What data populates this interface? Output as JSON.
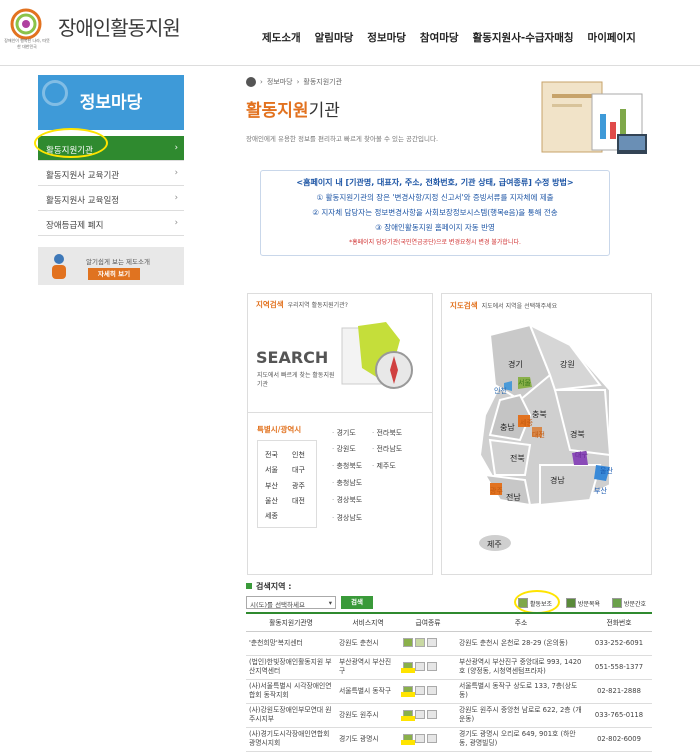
{
  "header": {
    "logo_title": "장애인활동지원",
    "logo_sub": "장애인이 행복한 나라, 따뜻한 대한민국",
    "gnb": [
      "제도소개",
      "알림마당",
      "정보마당",
      "참여마당",
      "활동지원사-수급자매칭",
      "마이페이지"
    ]
  },
  "sidebar": {
    "title": "정보마당",
    "items": [
      {
        "label": "활동지원기관",
        "active": true
      },
      {
        "label": "활동지원사 교육기관",
        "active": false
      },
      {
        "label": "활동지원사 교육일정",
        "active": false
      },
      {
        "label": "장애등급제 폐지",
        "active": false
      }
    ],
    "banner": {
      "text": "알기쉽게 보는 제도소개",
      "button": "자세히 보기"
    }
  },
  "breadcrumb": [
    "정보마당",
    "활동지원기관"
  ],
  "page": {
    "title_accent": "활동지원",
    "title_rest": "기관",
    "desc": "장애인에게 유용한 정보를 편리하고 빠르게 찾아볼 수 있는 공간입니다."
  },
  "notice": {
    "heading": "<홈페이지 내 [기관명, 대표자, 주소, 전화번호, 기관 상태, 급여종류] 수정 방법>",
    "lines": [
      "① 활동지원기관의 장은 '변경사항/지정 신고서'와 증빙서류를 지자체에 제출",
      "② 지자체 담당자는 정보변경사항을 사회보장정보시스템(행복e음)을 통해 전송",
      "③ 장애인활동지원 홈페이지 자동 반영"
    ],
    "warning": "*홈페이지 담당기관(국민연금공단)으로 변경요청시 변경 불가합니다."
  },
  "region_search": {
    "head": "지역검색",
    "head_sub": "우리지역 활동지원기관?",
    "search_word": "SEARCH",
    "search_sub": "지도에서 빠르게 찾는 활동지원기관",
    "metro_title": "특별시/광역시",
    "metro": [
      "전국",
      "인천",
      "서울",
      "대구",
      "부산",
      "광주",
      "울산",
      "대전",
      "세종"
    ],
    "provinces": [
      "경기도",
      "전라북도",
      "강원도",
      "전라남도",
      "충청북도",
      "제주도",
      "충청남도",
      "경상북도",
      "경상남도"
    ]
  },
  "map_search": {
    "head": "지도검색",
    "head_sub": "지도에서 지역을 선택해주세요",
    "labels": [
      "경기",
      "강원",
      "인천",
      "서울",
      "충북",
      "세종",
      "충남",
      "대전",
      "경북",
      "대구",
      "전북",
      "울산",
      "부산",
      "경남",
      "광주",
      "전남",
      "제주"
    ]
  },
  "results": {
    "title": "검색지역 :",
    "select_placeholder": "시(도)를 선택하세요",
    "search_button": "검색",
    "legend": [
      "활동보조",
      "방문목욕",
      "방문간호"
    ],
    "columns": [
      "활동지원기관명",
      "서비스지역",
      "급여종류",
      "주소",
      "전화번호"
    ],
    "rows": [
      {
        "name": "'춘천희망'복지센터",
        "area": "강원도 춘천시",
        "addr": "강원도 춘천시 온천로 28-29 (온의동)",
        "tel": "033-252-6091"
      },
      {
        "name": "(법인)한빛장애인활동지원 부산지역센터",
        "area": "부산광역시 부산진구",
        "addr": "부산광역시 부산진구 중앙대로 993, 1420호 (양정동, 시청역센텀프라자)",
        "tel": "051-558-1377"
      },
      {
        "name": "(사)서울특별시 시각장애인연합회 동작지회",
        "area": "서울특별시 동작구",
        "addr": "서울특별시 동작구 상도로 133, 7층(상도동)",
        "tel": "02-821-2888"
      },
      {
        "name": "(사)강원도장애인부모연대 원주시지부",
        "area": "강원도 원주시",
        "addr": "강원도 원주시 중앙천 남로로 622, 2층 (개운동)",
        "tel": "033-765-0118"
      },
      {
        "name": "(사)경기도시각장애인연합회 광명시지회",
        "area": "경기도 광명시",
        "addr": "경기도 광명시 오리로 649, 901호 (하안동, 광명빌딩)",
        "tel": "02-802-6009"
      }
    ]
  },
  "colors": {
    "accent": "#e2721f",
    "green": "#2f8a2f",
    "blue": "#3e9ad8"
  }
}
